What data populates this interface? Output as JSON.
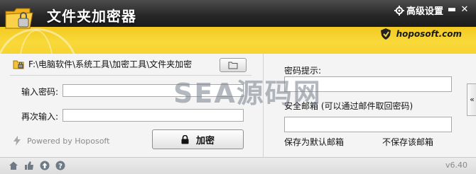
{
  "app": {
    "title": "文件夹加密器"
  },
  "header": {
    "settings_label": "高级设置",
    "brand": "hoposoft.com"
  },
  "left": {
    "path": "F:\\电脑软件\\系统工具\\加密工具\\文件夹加密",
    "password_label": "输入密码:",
    "password_value": "",
    "confirm_label": "再次输入:",
    "confirm_value": "",
    "powered_by": "Powered by Hoposoft",
    "encrypt_label": "加密"
  },
  "right": {
    "hint_label": "密码提示:",
    "hint_value": "",
    "email_label": "安全邮箱 (可以通过邮件取回密码)",
    "email_value": "",
    "save_default": "保存为默认邮箱",
    "no_save": "不保存该邮箱",
    "collapse_glyph": "«"
  },
  "footer": {
    "version": "v6.40"
  },
  "watermark": "SEA源码网",
  "icons": [
    "app-logo-icon",
    "gear-icon",
    "minimize-icon",
    "close-icon",
    "shield-icon",
    "folder-lock-icon",
    "folder-icon",
    "lock-icon",
    "lightning-icon",
    "home-icon",
    "thumbs-up-icon",
    "upload-icon",
    "help-icon"
  ],
  "colors": {
    "header_dark": "#262626",
    "header_yellow": "#f1c419",
    "panel_bg": "#f4f4f4"
  }
}
